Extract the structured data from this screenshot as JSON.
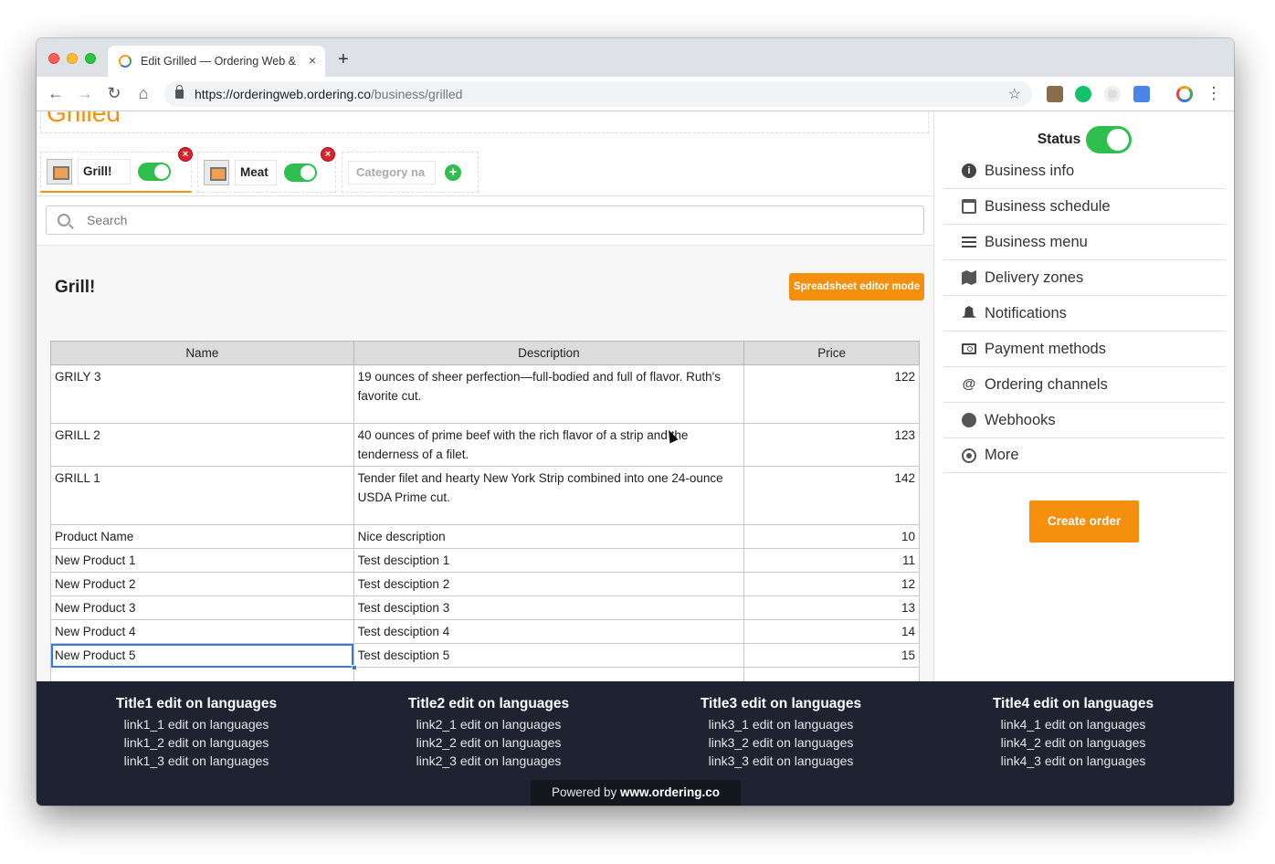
{
  "browser": {
    "tab_title": "Edit Grilled — Ordering Web &",
    "tab_close": "×",
    "new_tab": "+",
    "url_host": "https://orderingweb.ordering.co",
    "url_path": "/business/grilled",
    "nav": {
      "back": "←",
      "forward": "→",
      "reload": "↻",
      "home": "⌂",
      "bookmark": "☆",
      "menu": "⋮"
    }
  },
  "business": {
    "title": "Grilled"
  },
  "categories": [
    {
      "name": "Grill!",
      "enabled": true,
      "active": true,
      "remove": "×"
    },
    {
      "name": "Meat",
      "enabled": true,
      "active": false,
      "remove": "×"
    }
  ],
  "new_category": {
    "placeholder": "Category na",
    "add": "+"
  },
  "search": {
    "placeholder": "Search"
  },
  "products_section": {
    "heading": "Grill!",
    "sheet_button": "Spreadsheet editor mode",
    "columns": [
      "Name",
      "Description",
      "Price"
    ],
    "rows": [
      {
        "name": "GRILY 3",
        "description": "19 ounces of sheer perfection—full-bodied and full of flavor. Ruth's favorite cut.",
        "price": "122"
      },
      {
        "name": "GRILL 2",
        "description": "40 ounces of prime beef with the rich flavor of a strip and the tenderness of a filet.",
        "price": "123"
      },
      {
        "name": "GRILL 1",
        "description": "Tender filet and hearty New York Strip combined into one 24-ounce USDA Prime cut.",
        "price": "142"
      },
      {
        "name": "Product Name",
        "description": "Nice description",
        "price": "10"
      },
      {
        "name": "New Product 1",
        "description": "Test desciption 1",
        "price": "11"
      },
      {
        "name": "New Product 2",
        "description": "Test desciption 2",
        "price": "12"
      },
      {
        "name": "New Product 3",
        "description": "Test desciption 3",
        "price": "13"
      },
      {
        "name": "New Product 4",
        "description": "Test desciption 4",
        "price": "14"
      },
      {
        "name": "New Product 5",
        "description": "Test desciption 5",
        "price": "15"
      },
      {
        "name": "",
        "description": "",
        "price": ""
      }
    ]
  },
  "sidebar": {
    "status_label": "Status",
    "status_on": true,
    "menu": [
      {
        "label": "Business info",
        "icon": "info-icon"
      },
      {
        "label": "Business schedule",
        "icon": "calendar-icon"
      },
      {
        "label": "Business menu",
        "icon": "bars-icon"
      },
      {
        "label": "Delivery zones",
        "icon": "map-icon"
      },
      {
        "label": "Notifications",
        "icon": "bell-icon"
      },
      {
        "label": "Payment methods",
        "icon": "money-icon"
      },
      {
        "label": "Ordering channels",
        "icon": "at-icon"
      },
      {
        "label": "Webhooks",
        "icon": "globe-icon"
      },
      {
        "label": "More",
        "icon": "dot-circle-icon"
      }
    ],
    "create_order": "Create order"
  },
  "footer": {
    "columns": [
      {
        "title": "Title1 edit on languages",
        "links": [
          "link1_1 edit on languages",
          "link1_2 edit on languages",
          "link1_3 edit on languages"
        ]
      },
      {
        "title": "Title2 edit on languages",
        "links": [
          "link2_1 edit on languages",
          "link2_2 edit on languages",
          "link2_3 edit on languages"
        ]
      },
      {
        "title": "Title3 edit on languages",
        "links": [
          "link3_1 edit on languages",
          "link3_2 edit on languages",
          "link3_3 edit on languages"
        ]
      },
      {
        "title": "Title4 edit on languages",
        "links": [
          "link4_1 edit on languages",
          "link4_2 edit on languages",
          "link4_3 edit on languages"
        ]
      }
    ],
    "powered_prefix": "Powered by",
    "powered_link": "www.ordering.co"
  },
  "colors": {
    "accent": "#f5900f",
    "toggle_on": "#2fbf4f",
    "footer_bg": "#1f2230",
    "remove": "#d9232d"
  }
}
